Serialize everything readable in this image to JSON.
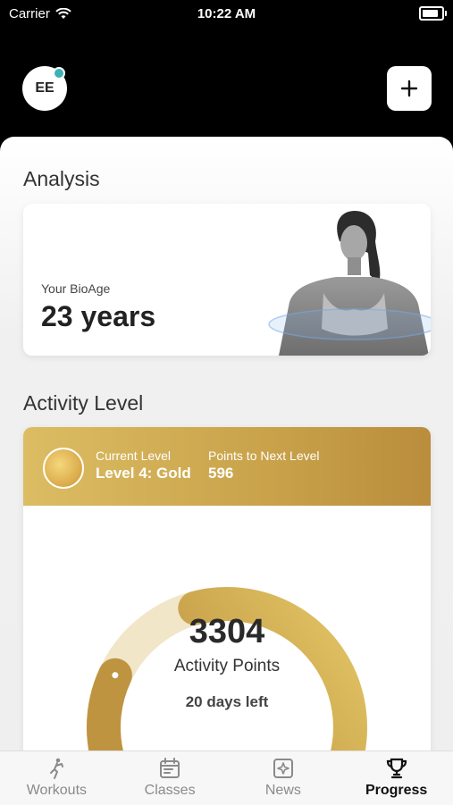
{
  "status_bar": {
    "carrier": "Carrier",
    "time": "10:22 AM",
    "battery_level": 0.95
  },
  "header": {
    "avatar_initials": "EE",
    "add_button_icon": "plus-icon"
  },
  "analysis": {
    "section_title": "Analysis",
    "bioage_label": "Your BioAge",
    "bioage_value": "23 years"
  },
  "activity": {
    "section_title": "Activity Level",
    "current_level_caption": "Current Level",
    "current_level_value": "Level 4: Gold",
    "points_to_next_caption": "Points to Next Level",
    "points_to_next_value": "596",
    "activity_points": "3304",
    "activity_points_label": "Activity Points",
    "days_left": "20 days left",
    "progress_fraction": 0.62
  },
  "tabs": [
    {
      "label": "Workouts",
      "icon": "workout-person-icon",
      "active": false
    },
    {
      "label": "Classes",
      "icon": "calendar-icon",
      "active": false
    },
    {
      "label": "News",
      "icon": "news-icon",
      "active": false
    },
    {
      "label": "Progress",
      "icon": "trophy-icon",
      "active": true
    }
  ],
  "colors": {
    "gold_light": "#dcbd63",
    "gold_dark": "#b98d3c",
    "badge_dot": "#3eb2b8"
  }
}
